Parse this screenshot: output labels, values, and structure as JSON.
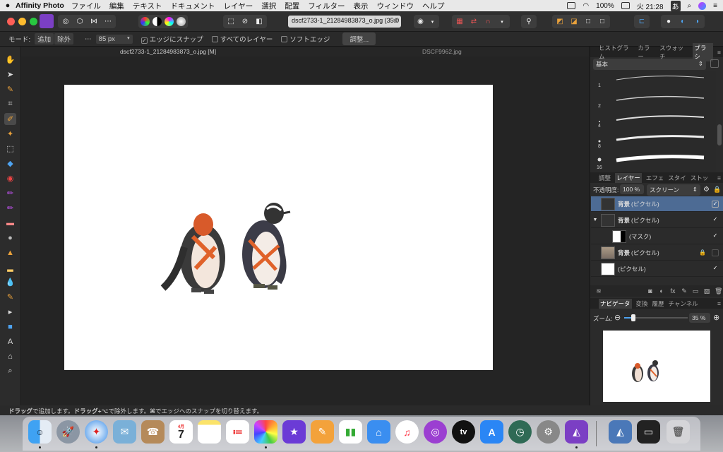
{
  "menubar": {
    "apple": "",
    "app": "Affinity Photo",
    "items": [
      "ファイル",
      "編集",
      "テキスト",
      "ドキュメント",
      "レイヤー",
      "選択",
      "配置",
      "フィルター",
      "表示",
      "ウィンドウ",
      "ヘルプ"
    ],
    "battery": "100%",
    "clock": "火 21:28",
    "input_method": "あ"
  },
  "toolbar": {
    "document": "dscf2733-1_21284983873_o.jpg (35.0"
  },
  "context": {
    "mode_label": "モード:",
    "mode_add": "追加",
    "mode_remove": "除外",
    "width_value": "85 px",
    "snap_edges": "エッジにスナップ",
    "all_layers": "すべてのレイヤー",
    "soft_edge": "ソフトエッジ",
    "adjust_button": "調整..."
  },
  "tabs": [
    "dscf2733-1_21284983873_o.jpg [M]",
    "DSCF9962.jpg"
  ],
  "brush_panel": {
    "tabs": [
      "ヒストグラム",
      "カラー",
      "スウォッチ",
      "ブラシ"
    ],
    "category": "基本",
    "brush_sizes": [
      "1",
      "2",
      "4",
      "8",
      "16"
    ]
  },
  "layers_panel": {
    "tabs": [
      "調整",
      "レイヤー",
      "エフェ",
      "スタイ",
      "ストッ"
    ],
    "opacity_label": "不透明度:",
    "opacity_value": "100 %",
    "blend_mode": "スクリーン",
    "layers": [
      {
        "name": "背景",
        "type": "(ピクセル)",
        "selected": true,
        "checked": true
      },
      {
        "name": "背景",
        "type": "(ピクセル)",
        "selected": false,
        "checked": true
      },
      {
        "name": "",
        "type": "(マスク)",
        "selected": false,
        "checked": true
      },
      {
        "name": "背景",
        "type": "(ピクセル)",
        "selected": false,
        "checked": false
      },
      {
        "name": "",
        "type": "(ピクセル)",
        "selected": false,
        "checked": true
      }
    ]
  },
  "navigator_panel": {
    "tabs": [
      "ナビゲータ",
      "変換",
      "履歴",
      "チャンネル"
    ],
    "zoom_label": "ズーム:",
    "zoom_value": "35 %"
  },
  "status": {
    "drag": "ドラッグ",
    "text1": "で追加します。",
    "drag_option": "ドラッグ+⌥",
    "text2": "で除外します。",
    "cmd": "⌘",
    "text3": "でエッジへのスナップを切り替えます。"
  },
  "dock": {
    "calendar_month": "4月",
    "calendar_day": "7",
    "tv_label": "tv"
  }
}
